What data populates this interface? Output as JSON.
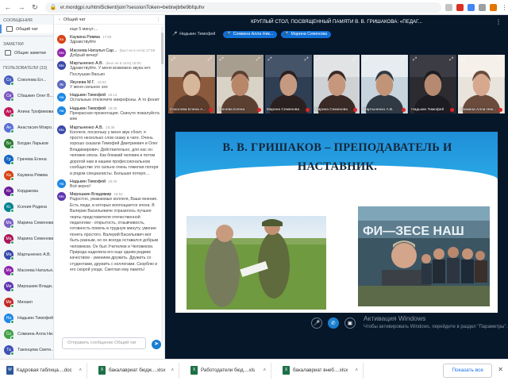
{
  "browser": {
    "url": "vr.mordgpi.ru/html5client/join?sessionToken=bebiwjb6e9bfquhv"
  },
  "sidebar": {
    "messages_title": "СООБЩЕНИЯ",
    "public_chat": "Общий чат",
    "notes_title": "ЗАМЕТКИ",
    "shared_notes": "Общие заметки",
    "users_title": "ПОЛЬЗОВАТЕЛИ (33)",
    "users": [
      {
        "initials": "Со",
        "name": "Соколова Ел...",
        "color": "#4a5fbf"
      },
      {
        "initials": "Св",
        "name": "Сбашкин Олег В...",
        "color": "#7a59c2"
      },
      {
        "initials": "Ал",
        "name": "Алина Трофимова",
        "color": "#c2185b"
      },
      {
        "initials": "Ан",
        "name": "Анастасия Мокро...",
        "color": "#5b6fd6"
      },
      {
        "initials": "Бо",
        "name": "Богдан Ларьков",
        "color": "#2e7d32"
      },
      {
        "initials": "Гр",
        "name": "Грачева Елена",
        "color": "#1565c0"
      },
      {
        "initials": "Ка",
        "name": "Каукина Римма",
        "color": "#d84315"
      },
      {
        "initials": "Ко",
        "name": "Кордакова",
        "color": "#6a1b9a"
      },
      {
        "initials": "Кс",
        "name": "Ксения Родина",
        "color": "#00838f"
      },
      {
        "initials": "Ма",
        "name": "Марина Семенова",
        "color": "#7b5fc4"
      },
      {
        "initials": "Ма",
        "name": "Марина Семенова",
        "color": "#ad1457"
      },
      {
        "initials": "Ма",
        "name": "Мартыненко А.В.",
        "color": "#3949ab"
      },
      {
        "initials": "Ма",
        "name": "Масеева Наталья...",
        "color": "#8e24aa"
      },
      {
        "initials": "Ми",
        "name": "Мирошкин Влади...",
        "color": "#5e35b1"
      },
      {
        "initials": "Ми",
        "name": "Михаил",
        "color": "#c62828"
      },
      {
        "initials": "На",
        "name": "Надькин Тимофей",
        "color": "#1e88e5"
      },
      {
        "initials": "Со",
        "name": "Сомкина Алла Ни...",
        "color": "#43a047"
      },
      {
        "initials": "Та",
        "name": "Таконцева Свети...",
        "color": "#3f51b5"
      }
    ]
  },
  "chat": {
    "title": "Общий чат",
    "input_placeholder": "Отправить сообщение Общий чат",
    "messages": [
      {
        "initials": "",
        "name": "",
        "time": "",
        "text": "еще 5 минут....",
        "color": "#6b57c4"
      },
      {
        "initials": "Ка",
        "name": "Каукина Римма",
        "time": "17:59",
        "text": "Здравствуйте",
        "color": "#d84315"
      },
      {
        "initials": "Ма",
        "name": "Масеева Наталья Сар...",
        "time": "(Был не в сети) 17:59",
        "text": "Добрый вечер!",
        "color": "#8e24aa"
      },
      {
        "initials": "Ма",
        "name": "Мартыненко А.В.",
        "time": "(Был не в сети) 18:00",
        "text": "Здравствуйте. У меня возможно звука нет. Послушаю Васько",
        "color": "#3949ab"
      },
      {
        "initials": "Як",
        "name": "Якунева М.Г.",
        "time": "18:02",
        "text": "У меня сильное эхо",
        "color": "#5c6bc0"
      },
      {
        "initials": "На",
        "name": "Надькин Тимофей",
        "time": "18:13",
        "text": "Остальные отключите микрофоны. А то фонит",
        "color": "#1e88e5"
      },
      {
        "initials": "На",
        "name": "Надькин Тимофей",
        "time": "18:25",
        "text": "Прекрасная презентация. Скинуте пожалуйста мне",
        "color": "#1e88e5"
      },
      {
        "initials": "Ма",
        "name": "Мартыненко А.В.",
        "time": "18:36",
        "text": "Коллеги, поскольку у меня звук сбоит, я просто несколько слов скажу в чате. Очень хорошо сказали Тимофей Дмитриевич и Олег Владимирович. Действительно, для нас он человек-эпоха. Как близкий человек и потом дорогой нам в нашем профессиональном сообществе это сильно очень тяжелая потеря и рядом специалисты. Большая потеря....",
        "color": "#3949ab"
      },
      {
        "initials": "На",
        "name": "Надькин Тимофей",
        "time": "18:40",
        "text": "Всё верно!",
        "color": "#1e88e5"
      },
      {
        "initials": "Ми",
        "name": "Мирошкин Владимир",
        "time": "18:52",
        "text": "Радостно, уважаемые коллеги, Ваше мнение. Есть люди, в которых воплощается эпоха. В Валерии Васильевиче отразилось лучшее черты представителя отечественной педагогики - открытость, отзывчивость, готовность помочь в трудную минуту, умение понять простого. Валерий Васильевич мог быть разным, но он всегда оставался добрым человеком. Он был Учителем и Человеком. Природа наделила его еще одним редким качеством - умением дружить. Дружить со студентами, дружить с коллегами. Скорблю и его скорой уходе. Светлая ему память!",
        "color": "#5e35b1"
      }
    ]
  },
  "meeting": {
    "title": "КРУГЛЫЙ СТОЛ, ПОСВЯЩЕННЫЙ ПАМЯТИ В. В. ГРИШАКОВА: «ПЕДАГ...",
    "talkers": [
      "Надькин Тимофей",
      "Сомкина Алла Ник...",
      "Марина Семенова"
    ],
    "cameras": [
      {
        "name": "Соколова Елена А...",
        "kind": "a"
      },
      {
        "name": "Грачева Елена",
        "kind": "b"
      },
      {
        "name": "Марина Семенова",
        "kind": "c"
      },
      {
        "name": "Марина Семенова",
        "kind": "d"
      },
      {
        "name": "Мартыненко А.В.",
        "kind": "e"
      },
      {
        "name": "Надькин Тимофей",
        "kind": "f"
      },
      {
        "name": "Сомкина Алла Ник...",
        "kind": "g"
      }
    ],
    "slide_title": "В. В. ГРИШАКОВ – ПРЕПОДАВАТЕЛЬ И НАСТАВНИК.",
    "banner_text": "ФИ—ЗЕСЕ НАШ"
  },
  "windows_activation": {
    "title": "Активация Windows",
    "text": "Чтобы активировать Windows, перейдите в раздел \"Параметры\"."
  },
  "downloads": {
    "items": [
      "Кадровая таблица....doc",
      "бакалавриат бюдж....xlsx",
      "Работодатели бюд....xls",
      "бакалавриат внеб....xlsx"
    ],
    "show_all": "Показать все"
  },
  "colors": {
    "accent": "#0f70d7",
    "main_bg": "#06172a",
    "sidebar_bg": "#f3f6f9"
  }
}
